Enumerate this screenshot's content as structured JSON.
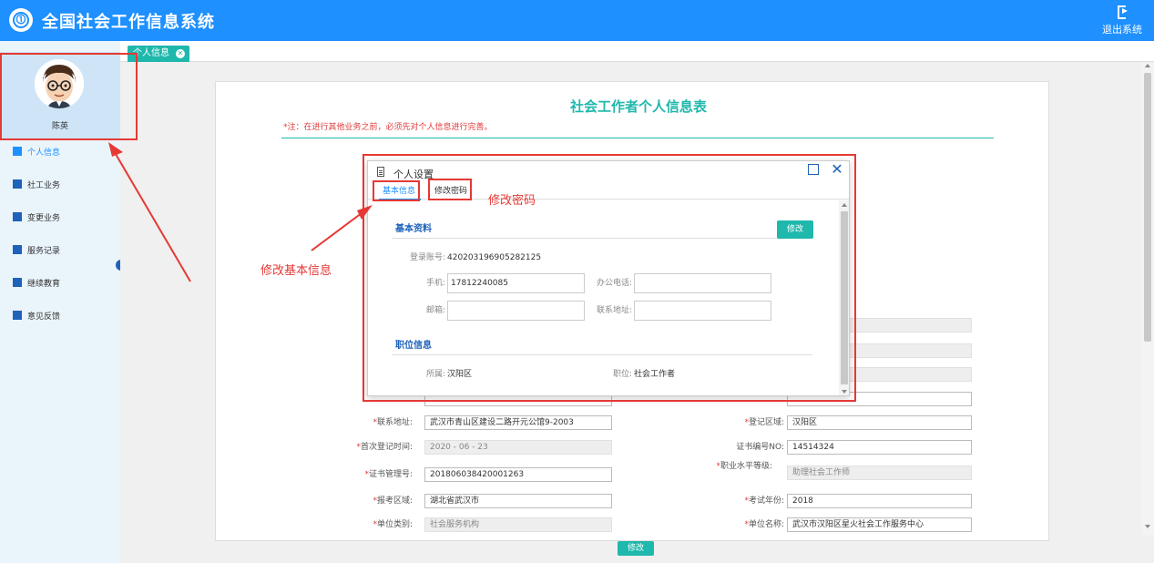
{
  "header": {
    "logo_glyph": "⓵",
    "title": "全国社会工作信息系统",
    "logout_label": "退出系统"
  },
  "sidebar": {
    "user_name": "陈英",
    "items": [
      {
        "label": "个人信息",
        "icon": "home-icon",
        "active": true
      },
      {
        "label": "社工业务",
        "icon": "users-icon"
      },
      {
        "label": "变更业务",
        "icon": "building-icon"
      },
      {
        "label": "服务记录",
        "icon": "chart-icon"
      },
      {
        "label": "继续教育",
        "icon": "education-icon"
      },
      {
        "label": "意见反馈",
        "icon": "feedback-icon"
      }
    ]
  },
  "tabbar": {
    "tab_label": "个人信息"
  },
  "form": {
    "title": "社会工作者个人信息表",
    "note": "*注：在进行其他业务之前，必须先对个人信息进行完善。",
    "rows": [
      {
        "left_label": "联系地址:",
        "left_req": true,
        "left_value": "武汉市青山区建设二路开元公馆9-2003",
        "left_disabled": false,
        "right_label": "登记区域:",
        "right_req": true,
        "right_value": "汉阳区",
        "right_disabled": false
      },
      {
        "left_label": "首次登记时间:",
        "left_req": true,
        "left_value": "2020 - 06 - 23",
        "left_disabled": true,
        "right_label": "证书编号NO:",
        "right_req": false,
        "right_value": "14514324",
        "right_disabled": false
      },
      {
        "left_label": "证书管理号:",
        "left_req": true,
        "left_value": "201806038420001263",
        "left_disabled": false,
        "right_label": "职业水平等级:",
        "right_req": true,
        "right_value": "助理社会工作师",
        "right_disabled": true
      },
      {
        "left_label": "报考区域:",
        "left_req": true,
        "left_value": "湖北省武汉市",
        "left_disabled": false,
        "right_label": "考试年份:",
        "right_req": true,
        "right_value": "2018",
        "right_disabled": false
      },
      {
        "left_label": "单位类别:",
        "left_req": true,
        "left_value": "社会服务机构",
        "left_disabled": true,
        "right_label": "单位名称:",
        "right_req": true,
        "right_value": "武汉市汉阳区星火社会工作服务中心",
        "right_disabled": false
      }
    ],
    "submit_label": "修改"
  },
  "modal": {
    "title": "个人设置",
    "tabs": [
      "基本信息",
      "修改密码"
    ],
    "section_basic": "基本资料",
    "edit_label": "修改",
    "account_label": "登录账号:",
    "account_value": "420203196905282125",
    "phone_label": "手机:",
    "phone_value": "17812240085",
    "office_phone_label": "办公电话:",
    "office_phone_value": "",
    "email_label": "邮箱:",
    "email_value": "",
    "address_label": "联系地址:",
    "address_value": "",
    "section_position": "职位信息",
    "belong_label": "所属:",
    "belong_value": "汉阳区",
    "position_label": "职位:",
    "position_value": "社会工作者"
  },
  "annotations": {
    "change_password": "修改密码",
    "edit_basic_info": "修改基本信息",
    "color": "#e53935"
  },
  "colors": {
    "header": "#1e90ff",
    "accent_teal": "#1fb8ac",
    "note_red": "#e03a3a"
  }
}
